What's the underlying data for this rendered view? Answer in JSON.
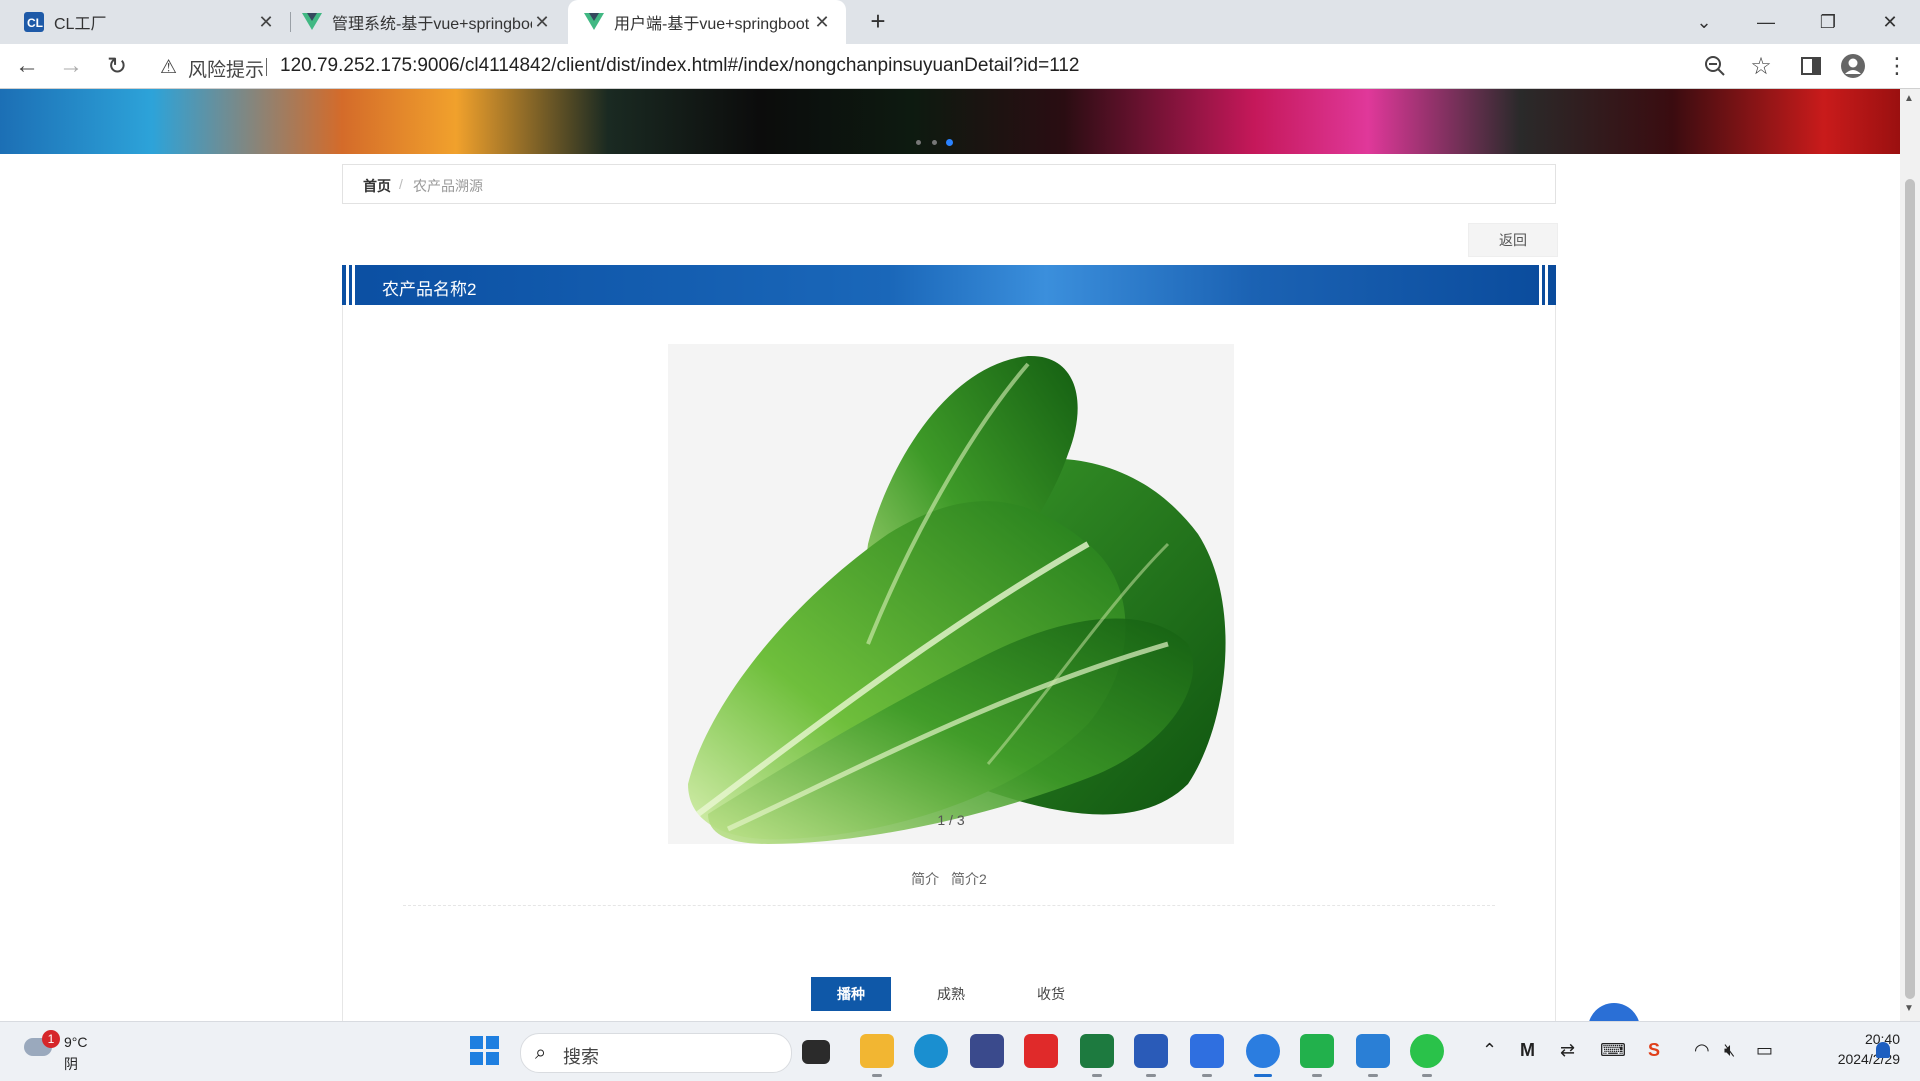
{
  "browser": {
    "tabs": [
      {
        "title": "CL工厂"
      },
      {
        "title": "管理系统-基于vue+springboot"
      },
      {
        "title": "用户端-基于vue+springboot"
      }
    ],
    "new_tab": "+",
    "security_label": "风险提示",
    "url": "120.79.252.175:9006/cl4114842/client/dist/index.html#/index/nongchanpinsuyuanDetail?id=112"
  },
  "page": {
    "breadcrumb": {
      "home": "首页",
      "separator": "/",
      "current": "农产品溯源"
    },
    "back_label": "返回",
    "product_title": "农产品名称2",
    "gallery_counter": "1 / 3",
    "summary_label": "简介",
    "summary_value": "简介2",
    "tabs": [
      {
        "label": "播种",
        "active": true
      },
      {
        "label": "成熟",
        "active": false
      },
      {
        "label": "收货",
        "active": false
      }
    ]
  },
  "taskbar": {
    "weather_temp": "9°C",
    "weather_cond": "阴",
    "weather_badge": "1",
    "search_placeholder": "搜索",
    "time": "20:40",
    "date": "2024/2/29"
  },
  "colors": {
    "accent_blue": "#0f58a8",
    "title_gradient_dark": "#0b4fa2",
    "title_gradient_light": "#3b8fdc"
  }
}
